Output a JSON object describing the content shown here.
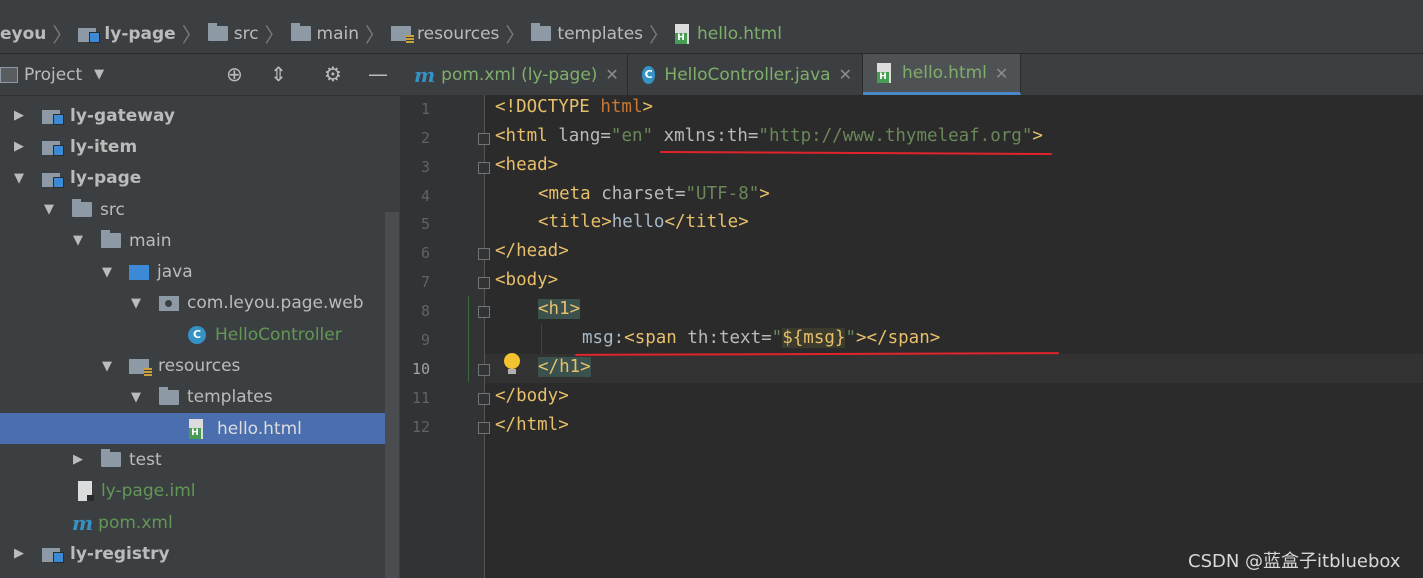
{
  "breadcrumb": {
    "items": [
      "eyou",
      "ly-page",
      "src",
      "main",
      "resources",
      "templates",
      "hello.html"
    ]
  },
  "project_panel": {
    "title": "Project",
    "tree": [
      {
        "label": "ly-gateway",
        "type": "module",
        "depth": 0,
        "expanded": false
      },
      {
        "label": "ly-item",
        "type": "module",
        "depth": 0,
        "expanded": false
      },
      {
        "label": "ly-page",
        "type": "module",
        "depth": 0,
        "expanded": true
      },
      {
        "label": "src",
        "type": "folder",
        "depth": 1,
        "expanded": true
      },
      {
        "label": "main",
        "type": "folder",
        "depth": 2,
        "expanded": true
      },
      {
        "label": "java",
        "type": "source-folder",
        "depth": 3,
        "expanded": true
      },
      {
        "label": "com.leyou.page.web",
        "type": "package",
        "depth": 4,
        "expanded": true
      },
      {
        "label": "HelloController",
        "type": "class",
        "depth": 5
      },
      {
        "label": "resources",
        "type": "resource-folder",
        "depth": 3,
        "expanded": true
      },
      {
        "label": "templates",
        "type": "folder",
        "depth": 4,
        "expanded": true
      },
      {
        "label": "hello.html",
        "type": "html",
        "depth": 5,
        "selected": true
      },
      {
        "label": "test",
        "type": "folder",
        "depth": 2,
        "expanded": false
      },
      {
        "label": "ly-page.iml",
        "type": "iml",
        "depth": 1
      },
      {
        "label": "pom.xml",
        "type": "maven",
        "depth": 1
      },
      {
        "label": "ly-registry",
        "type": "module",
        "depth": 0,
        "expanded": false
      }
    ]
  },
  "tabs": [
    {
      "label": "pom.xml (ly-page)",
      "icon": "maven-icon",
      "active": false
    },
    {
      "label": "HelloController.java",
      "icon": "class-icon",
      "active": false
    },
    {
      "label": "hello.html",
      "icon": "html-file-icon",
      "active": true
    }
  ],
  "editor": {
    "line_numbers": [
      "1",
      "2",
      "3",
      "4",
      "5",
      "6",
      "7",
      "8",
      "9",
      "10",
      "11",
      "12"
    ],
    "current_line": "10"
  },
  "code": {
    "l1_doctype": "<!DOCTYPE",
    "l1_html": " html",
    "l1_close": ">",
    "l2_open": "<html",
    "l2_lang": " lang=",
    "l2_lang_val": "\"en\"",
    "l2_xmlns": " xmlns:th=",
    "l2_xmlns_val": "\"http://www.thymeleaf.org\"",
    "l2_close": ">",
    "l3": "<head>",
    "l4_open": "<meta",
    "l4_attr": " charset=",
    "l4_val": "\"UTF-8\"",
    "l4_close": ">",
    "l5_open": "<title>",
    "l5_text": "hello",
    "l5_close": "</title>",
    "l6": "</head>",
    "l7": "<body>",
    "l8": "<h1>",
    "l9_text": "msg:",
    "l9_open": "<span",
    "l9_attr": " th:text=",
    "l9_q1": "\"",
    "l9_expr": "${msg}",
    "l9_q2": "\"",
    "l9_gt": ">",
    "l9_close": "</span>",
    "l10": "</h1>",
    "l11": "</body>",
    "l12": "</html>"
  },
  "watermark": "CSDN @蓝盒子itbluebox",
  "colors": {
    "tag": "#e8bf6a",
    "string": "#6a8759",
    "text": "#a9b7c6",
    "selection": "#4b6eaf",
    "annotation_underline": "#e0242b"
  }
}
